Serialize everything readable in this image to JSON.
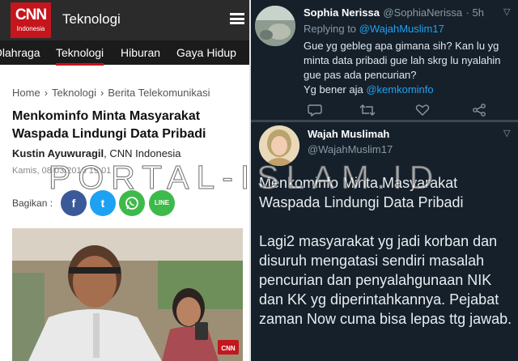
{
  "cnn": {
    "logo_main": "CNN",
    "logo_sub": "Indonesia",
    "section": "Teknologi",
    "nav_items": [
      "Olahraga",
      "Teknologi",
      "Hiburan",
      "Gaya Hidup"
    ],
    "breadcrumb": [
      "Home",
      "Teknologi",
      "Berita Telekomunikasi"
    ],
    "breadcrumb_sep": "›",
    "headline": "Menkominfo Minta Masyarakat Waspada Lindungi Data Pribadi",
    "author": "Kustin Ayuwuragil",
    "publisher": ", CNN Indonesia",
    "date": "Kamis, 08/03/2018 19:01",
    "share_label": "Bagikan :",
    "share_buttons": [
      "f",
      "t",
      "w",
      "LINE"
    ],
    "photo_badge": "CNN"
  },
  "tweet1": {
    "name": "Sophia Nerissa",
    "handle": "@SophiaNerissa",
    "time": "· 5h",
    "reply_prefix": "Replying to ",
    "reply_to": "@WajahMuslim17",
    "body": "Gue yg gebleg apa gimana sih? Kan lu yg minta data pribadi gue lah skrg lu nyalahin gue pas ada pencurian?",
    "body_tail": "Yg bener aja ",
    "mention": "@kemkominfo"
  },
  "tweet2": {
    "name": "Wajah Muslimah",
    "handle": "@WajahMuslim17",
    "para1": "Menkominfo Minta Masyarakat Waspada Lindungi Data Pribadi",
    "para2": "Lagi2 masyarakat yg jadi korban dan disuruh mengatasi sendiri masalah pencurian dan penyalahgunaan NIK dan KK yg diperintahkannya. Pejabat zaman Now cuma bisa lepas ttg jawab."
  },
  "watermark": "PORTAL-ISLAM.ID",
  "colors": {
    "cnn_red": "#c4161c",
    "twitter_bg": "#15202b",
    "twitter_blue": "#1da1f2",
    "facebook": "#3b5998",
    "twitter_share": "#1da1f2",
    "whatsapp": "#3dba4a",
    "line": "#3dba4a"
  }
}
